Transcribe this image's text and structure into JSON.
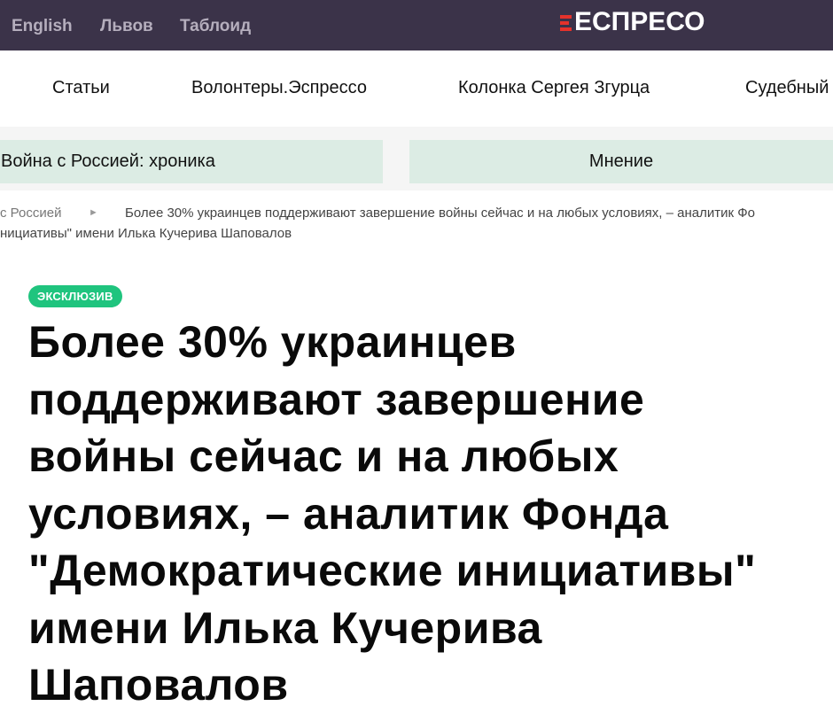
{
  "topbar": {
    "languages": [
      "English",
      "Львов",
      "Таблоид"
    ],
    "logo_text": "ЕСПРЕСО",
    "logo_accent_color": "#e4322b",
    "background": "#3b3349"
  },
  "nav": {
    "items": [
      "Статьи",
      "Волонтеры.Эспрессо",
      "Колонка Сергея Згурца",
      "Судебный"
    ]
  },
  "categories": [
    "Война с Россией: хроника",
    "Мнение"
  ],
  "breadcrumb": {
    "parent": "с Россией",
    "current_line1": "Более 30% украинцев поддерживают завершение войны сейчас и на любых условиях, – аналитик Фо",
    "current_line2": "нициативы\" имени Илька Кучерива Шаповалов"
  },
  "article": {
    "badge": "ЭКСКЛЮЗИВ",
    "badge_color": "#1fc47e",
    "title_lines": [
      "Более 30% украинцев",
      "поддерживают завершение",
      "войны сейчас и на любых",
      "условиях, – аналитик Фонда",
      "\"Демократические инициативы\"",
      "имени Илька Кучерива",
      "Шаповалов"
    ]
  }
}
